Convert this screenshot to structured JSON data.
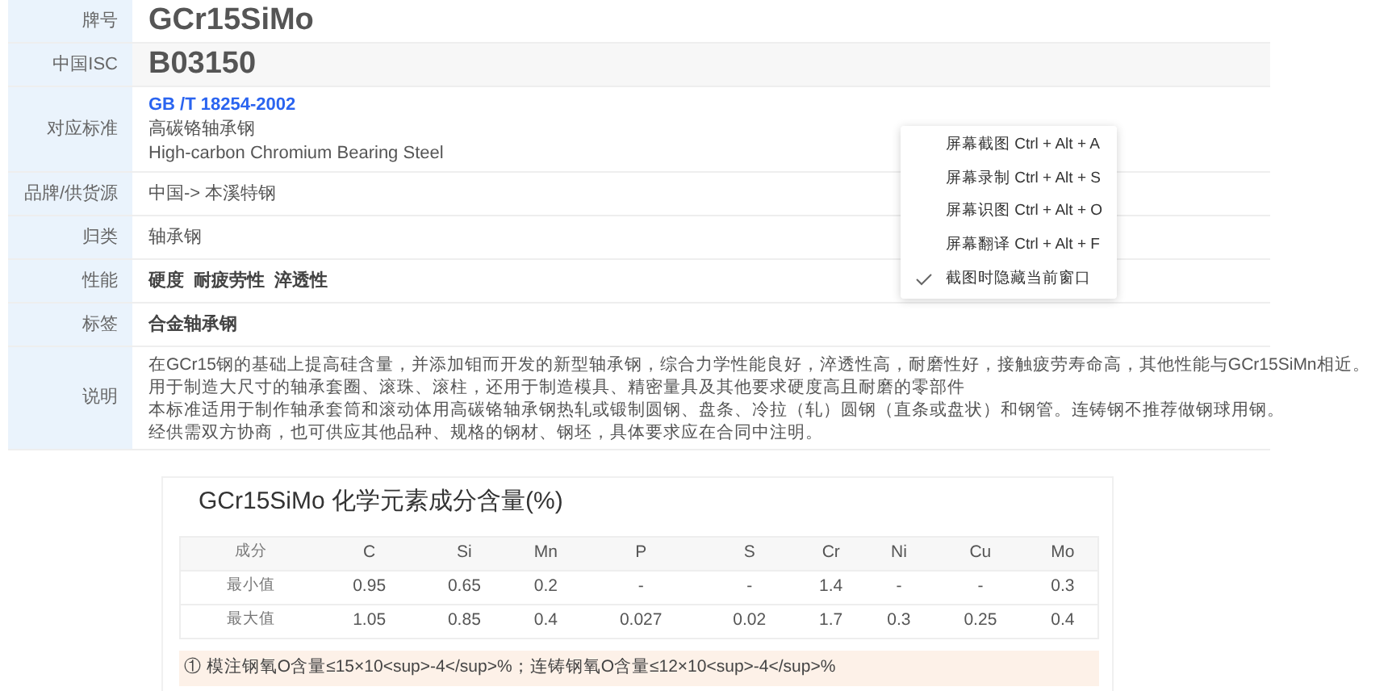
{
  "details": [
    {
      "kind": "title",
      "label": "牌号",
      "value": "GCr15SiMo"
    },
    {
      "kind": "title",
      "label": "中国ISC",
      "value": "B03150"
    },
    {
      "kind": "standard",
      "label": "对应标准",
      "link": "GB /T 18254-2002",
      "lines": [
        "高碳铬轴承钢",
        "High-carbon Chromium Bearing Steel"
      ]
    },
    {
      "kind": "plain",
      "label": "品牌/供货源",
      "value": "中国-> 本溪特钢"
    },
    {
      "kind": "plain",
      "label": "归类",
      "value": "轴承钢"
    },
    {
      "kind": "tags",
      "label": "性能",
      "tags": [
        "硬度",
        "耐疲劳性",
        "淬透性"
      ]
    },
    {
      "kind": "tags",
      "label": "标签",
      "tags": [
        "合金轴承钢"
      ]
    },
    {
      "kind": "text",
      "label": "说明",
      "lines": [
        "在GCr15钢的基础上提高硅含量，并添加钼而开发的新型轴承钢，综合力学性能良好，淬透性高，耐磨性好，接触疲劳寿命高，其他性能与GCr15SiMn相近。",
        "用于制造大尺寸的轴承套圈、滚珠、滚柱，还用于制造模具、精密量具及其他要求硬度高且耐磨的零部件",
        "本标准适用于制作轴承套筒和滚动体用高碳铬轴承钢热轧或锻制圆钢、盘条、冷拉（轧）圆钢（直条或盘状）和钢管。连铸钢不推荐做钢球用钢。",
        "经供需双方协商，也可供应其他品种、规格的钢材、钢坯，具体要求应在合同中注明。"
      ]
    }
  ],
  "composition": {
    "title": "GCr15SiMo 化学元素成分含量(%)",
    "columns": [
      "成分",
      "C",
      "Si",
      "Mn",
      "P",
      "S",
      "Cr",
      "Ni",
      "Cu",
      "Mo"
    ],
    "rows": [
      [
        "最小值",
        "0.95",
        "0.65",
        "0.2",
        "-",
        "-",
        "1.4",
        "-",
        "-",
        "0.3"
      ],
      [
        "最大值",
        "1.05",
        "0.85",
        "0.4",
        "0.027",
        "0.02",
        "1.7",
        "0.3",
        "0.25",
        "0.4"
      ]
    ],
    "note": "① 模注钢氧O含量≤15×10<sup>-4</sup>%；连铸钢氧O含量≤12×10<sup>-4</sup>%"
  },
  "context_menu": [
    {
      "label": "屏幕截图 Ctrl + Alt + A",
      "checked": false
    },
    {
      "label": "屏幕录制 Ctrl + Alt + S",
      "checked": false
    },
    {
      "label": "屏幕识图 Ctrl + Alt + O",
      "checked": false
    },
    {
      "label": "屏幕翻译 Ctrl + Alt + F",
      "checked": false
    },
    {
      "label": "截图时隐藏当前窗口",
      "checked": true
    }
  ]
}
